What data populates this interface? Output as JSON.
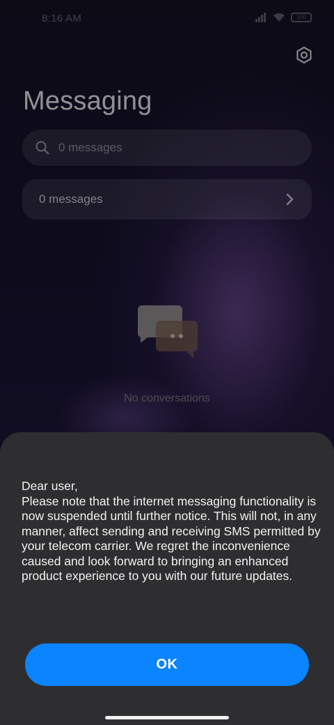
{
  "status_bar": {
    "time": "8:16 AM",
    "battery": "100"
  },
  "header": {
    "title": "Messaging",
    "settings_icon": "gear-icon"
  },
  "search": {
    "placeholder": "0 messages",
    "icon": "search-icon"
  },
  "messages_row": {
    "label": "0 messages",
    "icon": "chevron-right-icon"
  },
  "empty_state": {
    "icon": "chat-bubbles-icon",
    "text": "No conversations"
  },
  "dialog": {
    "lines": [
      "Dear user,",
      "Please note that the internet messaging functionality is now suspended until further notice. This will not, in any manner, affect sending and receiving SMS permitted by your telecom carrier. We regret the inconvenience caused and look forward to bringing an enhanced product experience to you with our future updates."
    ],
    "ok_label": "OK"
  },
  "colors": {
    "accent": "#0a84ff",
    "sheet_bg": "#2e2e30",
    "background": "#12101f"
  }
}
